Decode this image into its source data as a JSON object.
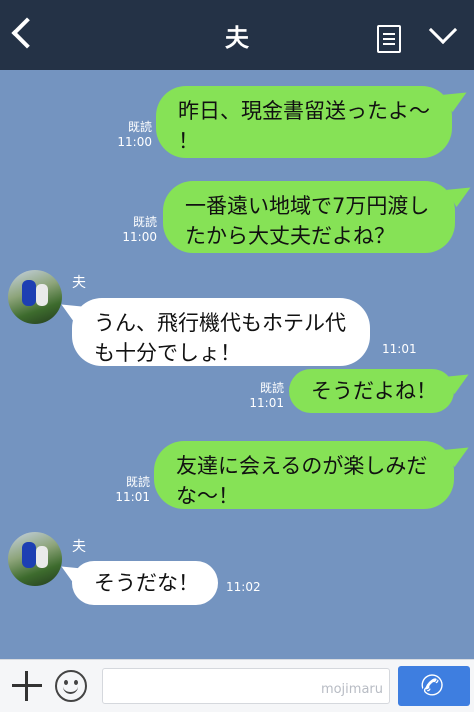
{
  "header": {
    "title": "夫"
  },
  "messages": [
    {
      "line1": "昨日、現金書留送ったよ〜",
      "line2": "！",
      "read": "既読",
      "time": "11:00"
    },
    {
      "line1": "一番遠い地域で7万円渡し",
      "line2": "たから大丈夫だよね？",
      "read": "既読",
      "time": "11:00"
    },
    {
      "sender": "夫",
      "line1": "うん、飛行機代もホテル代",
      "line2": "も十分でしょ！",
      "time": "11:01"
    },
    {
      "line1": "そうだよね！",
      "read": "既読",
      "time": "11:01"
    },
    {
      "line1": "友達に会えるのが楽しみだ",
      "line2": "な〜！",
      "read": "既読",
      "time": "11:01"
    },
    {
      "sender": "夫",
      "line1": "そうだな！",
      "time": "11:02"
    }
  ],
  "footer": {
    "watermark": "mojimaru"
  },
  "colors": {
    "background": "#7494c0",
    "header": "#243246",
    "outgoing": "#86e256",
    "incoming": "#ffffff",
    "call": "#3e7ee0"
  }
}
